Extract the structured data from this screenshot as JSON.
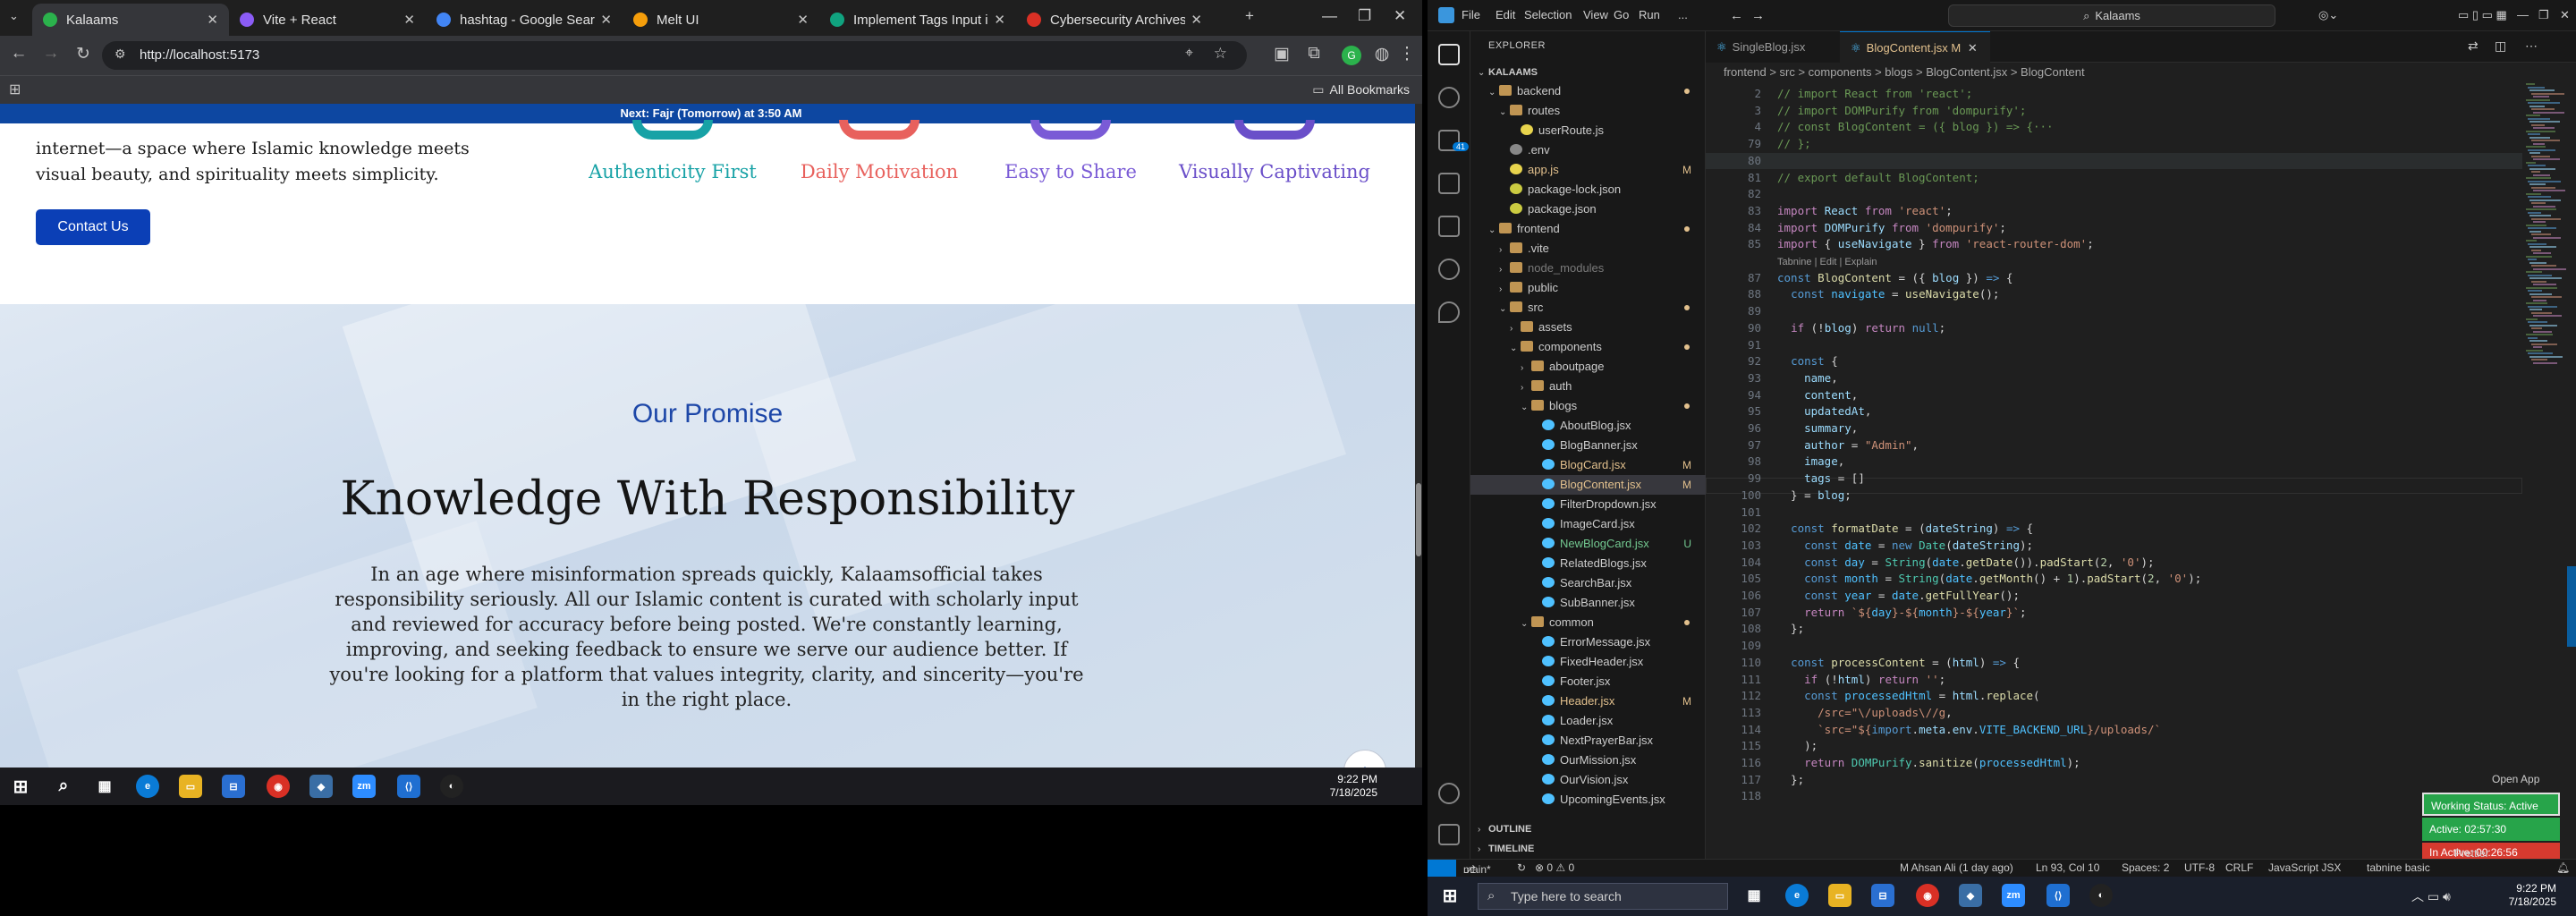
{
  "browser": {
    "tabs": [
      {
        "title": "Kalaams",
        "active": true,
        "color": "#2bb24c"
      },
      {
        "title": "Vite + React",
        "active": false,
        "color": "#8b5cf6"
      },
      {
        "title": "hashtag - Google Search",
        "active": false,
        "color": "#4285f4"
      },
      {
        "title": "Melt UI",
        "active": false,
        "color": "#f59e0b"
      },
      {
        "title": "Implement Tags Input in Blo",
        "active": false,
        "color": "#10a37f"
      },
      {
        "title": "Cybersecurity Archives - vCh",
        "active": false,
        "color": "#d93025"
      }
    ],
    "url": "http://localhost:5173",
    "bookmarks_label": "All Bookmarks"
  },
  "site": {
    "prayer_bar": "Next: Fajr (Tomorrow) at 3:50 AM",
    "hero_text": "internet—a space where Islamic knowledge meets visual beauty, and spirituality meets simplicity.",
    "contact_label": "Contact Us",
    "features": [
      {
        "label": "Authenticity First",
        "color": "#17a2a6"
      },
      {
        "label": "Daily Motivation",
        "color": "#e8615d"
      },
      {
        "label": "Easy to Share",
        "color": "#7a5bd6"
      },
      {
        "label": "Visually Captivating",
        "color": "#6a4fc9"
      }
    ],
    "promise_subtitle": "Our Promise",
    "promise_title": "Knowledge With Responsibility",
    "promise_body": "In an age where misinformation spreads quickly, Kalaamsofficial takes responsibility seriously. All our Islamic content is curated with scholarly input and reviewed for accuracy before being posted. We're constantly learning, improving, and seeking feedback to ensure we serve our audience better. If you're looking for a platform that values integrity, clarity, and sincerity—you're in the right place."
  },
  "left_taskbar": {
    "time": "9:22 PM",
    "date": "7/18/2025"
  },
  "vscode": {
    "menu": [
      "File",
      "Edit",
      "Selection",
      "View",
      "Go",
      "Run",
      "..."
    ],
    "search": "Kalaams",
    "explorer_title": "EXPLORER",
    "tree": [
      {
        "label": "KALAAMS",
        "depth": 0,
        "kind": "root",
        "chev": "⌄"
      },
      {
        "label": "backend",
        "depth": 1,
        "kind": "folder",
        "chev": "⌄",
        "dot": "#e2c08d"
      },
      {
        "label": "routes",
        "depth": 2,
        "kind": "folder",
        "chev": "⌄"
      },
      {
        "label": "userRoute.js",
        "depth": 3,
        "kind": "js"
      },
      {
        "label": ".env",
        "depth": 2,
        "kind": "env"
      },
      {
        "label": "app.js",
        "depth": 2,
        "kind": "js",
        "mark": "M",
        "color": "#e2c08d"
      },
      {
        "label": "package-lock.json",
        "depth": 2,
        "kind": "json"
      },
      {
        "label": "package.json",
        "depth": 2,
        "kind": "json"
      },
      {
        "label": "frontend",
        "depth": 1,
        "kind": "folder",
        "chev": "⌄",
        "dot": "#e2c08d"
      },
      {
        "label": ".vite",
        "depth": 2,
        "kind": "folder",
        "chev": "›"
      },
      {
        "label": "node_modules",
        "depth": 2,
        "kind": "folder",
        "chev": "›",
        "dim": true
      },
      {
        "label": "public",
        "depth": 2,
        "kind": "folder",
        "chev": "›"
      },
      {
        "label": "src",
        "depth": 2,
        "kind": "folder",
        "chev": "⌄",
        "dot": "#e2c08d"
      },
      {
        "label": "assets",
        "depth": 3,
        "kind": "folder",
        "chev": "›"
      },
      {
        "label": "components",
        "depth": 3,
        "kind": "folder",
        "chev": "⌄",
        "dot": "#e2c08d"
      },
      {
        "label": "aboutpage",
        "depth": 4,
        "kind": "folder",
        "chev": "›"
      },
      {
        "label": "auth",
        "depth": 4,
        "kind": "folder",
        "chev": "›"
      },
      {
        "label": "blogs",
        "depth": 4,
        "kind": "folder",
        "chev": "⌄",
        "dot": "#e2c08d"
      },
      {
        "label": "AboutBlog.jsx",
        "depth": 5,
        "kind": "jsx"
      },
      {
        "label": "BlogBanner.jsx",
        "depth": 5,
        "kind": "jsx"
      },
      {
        "label": "BlogCard.jsx",
        "depth": 5,
        "kind": "jsx",
        "mark": "M",
        "color": "#e2c08d"
      },
      {
        "label": "BlogContent.jsx",
        "depth": 5,
        "kind": "jsx",
        "mark": "M",
        "color": "#e2c08d",
        "selected": true
      },
      {
        "label": "FilterDropdown.jsx",
        "depth": 5,
        "kind": "jsx"
      },
      {
        "label": "ImageCard.jsx",
        "depth": 5,
        "kind": "jsx"
      },
      {
        "label": "NewBlogCard.jsx",
        "depth": 5,
        "kind": "jsx",
        "mark": "U",
        "color": "#73c991"
      },
      {
        "label": "RelatedBlogs.jsx",
        "depth": 5,
        "kind": "jsx"
      },
      {
        "label": "SearchBar.jsx",
        "depth": 5,
        "kind": "jsx"
      },
      {
        "label": "SubBanner.jsx",
        "depth": 5,
        "kind": "jsx"
      },
      {
        "label": "common",
        "depth": 4,
        "kind": "folder",
        "chev": "⌄",
        "dot": "#e2c08d"
      },
      {
        "label": "ErrorMessage.jsx",
        "depth": 5,
        "kind": "jsx"
      },
      {
        "label": "FixedHeader.jsx",
        "depth": 5,
        "kind": "jsx"
      },
      {
        "label": "Footer.jsx",
        "depth": 5,
        "kind": "jsx"
      },
      {
        "label": "Header.jsx",
        "depth": 5,
        "kind": "jsx",
        "mark": "M",
        "color": "#e2c08d"
      },
      {
        "label": "Loader.jsx",
        "depth": 5,
        "kind": "jsx"
      },
      {
        "label": "NextPrayerBar.jsx",
        "depth": 5,
        "kind": "jsx"
      },
      {
        "label": "OurMission.jsx",
        "depth": 5,
        "kind": "jsx"
      },
      {
        "label": "OurVision.jsx",
        "depth": 5,
        "kind": "jsx"
      },
      {
        "label": "UpcomingEvents.jsx",
        "depth": 5,
        "kind": "jsx"
      }
    ],
    "outline_label": "OUTLINE",
    "timeline_label": "TIMELINE",
    "editor_tabs": [
      {
        "label": "SingleBlog.jsx",
        "active": false
      },
      {
        "label": "BlogContent.jsx",
        "active": true,
        "mark": "M"
      }
    ],
    "breadcrumb": "frontend > src > components > blogs > BlogContent.jsx > BlogContent",
    "code_lines": [
      {
        "n": "2",
        "html": "<span class=\"cm\">// import React from 'react';</span>"
      },
      {
        "n": "3",
        "html": "<span class=\"cm\">// import DOMPurify from 'dompurify';</span>"
      },
      {
        "n": "4",
        "html": "<span class=\"cm\">// const BlogContent = ({ blog }) =&gt; {···</span>"
      },
      {
        "n": "79",
        "html": "<span class=\"cm\">// };</span>"
      },
      {
        "n": "80",
        "html": ""
      },
      {
        "n": "81",
        "html": "<span class=\"cm\">// export default BlogContent;</span>"
      },
      {
        "n": "82",
        "html": ""
      },
      {
        "n": "83",
        "html": "<span class=\"kc\">import</span> <span class=\"vr\">React</span> <span class=\"kc\">from</span> <span class=\"st\">'react'</span>;"
      },
      {
        "n": "84",
        "html": "<span class=\"kc\">import</span> <span class=\"vr\">DOMPurify</span> <span class=\"kc\">from</span> <span class=\"st\">'dompurify'</span>;"
      },
      {
        "n": "85",
        "html": "<span class=\"kc\">import</span> { <span class=\"vr\">useNavigate</span> } <span class=\"kc\">from</span> <span class=\"st\">'react-router-dom'</span>;"
      },
      {
        "n": "",
        "html": "<span style=\"color:#999;font-family:'Liberation Sans',sans-serif;font-size:11px\">Tabnine | Edit | Explain</span>"
      },
      {
        "n": "87",
        "html": "<span class=\"kw\">const</span> <span class=\"fn\">BlogContent</span> = ({ <span class=\"vr\">blog</span> }) <span class=\"kw\">=&gt;</span> {"
      },
      {
        "n": "88",
        "html": "  <span class=\"kw\">const</span> <span class=\"cn\">navigate</span> = <span class=\"fn\">useNavigate</span>();"
      },
      {
        "n": "89",
        "html": ""
      },
      {
        "n": "90",
        "html": "  <span class=\"kc\">if</span> (!<span class=\"vr\">blog</span>) <span class=\"kc\">return</span> <span class=\"kw\">null</span>;"
      },
      {
        "n": "91",
        "html": ""
      },
      {
        "n": "92",
        "html": "  <span class=\"kw\">const</span> {"
      },
      {
        "n": "93",
        "html": "    <span class=\"vr\">name</span>,"
      },
      {
        "n": "94",
        "html": "    <span class=\"vr\">content</span>,"
      },
      {
        "n": "95",
        "html": "    <span class=\"vr\">updatedAt</span>,"
      },
      {
        "n": "96",
        "html": "    <span class=\"vr\">summary</span>,"
      },
      {
        "n": "97",
        "html": "    <span class=\"vr\">author</span> = <span class=\"st\">\"Admin\"</span>,"
      },
      {
        "n": "98",
        "html": "    <span class=\"vr\">image</span>,"
      },
      {
        "n": "99",
        "html": "    <span class=\"vr\">tags</span> = []"
      },
      {
        "n": "100",
        "html": "  } = <span class=\"vr\">blog</span>;"
      },
      {
        "n": "101",
        "html": ""
      },
      {
        "n": "102",
        "html": "  <span class=\"kw\">const</span> <span class=\"fn\">formatDate</span> = (<span class=\"vr\">dateString</span>) <span class=\"kw\">=&gt;</span> {"
      },
      {
        "n": "103",
        "html": "    <span class=\"kw\">const</span> <span class=\"cn\">date</span> = <span class=\"kw\">new</span> <span class=\"ty\">Date</span>(<span class=\"vr\">dateString</span>);"
      },
      {
        "n": "104",
        "html": "    <span class=\"kw\">const</span> <span class=\"cn\">day</span> = <span class=\"ty\">String</span>(<span class=\"cn\">date</span>.<span class=\"fn\">getDate</span>()).<span class=\"fn\">padStart</span>(<span class=\"nu\">2</span>, <span class=\"st\">'0'</span>);"
      },
      {
        "n": "105",
        "html": "    <span class=\"kw\">const</span> <span class=\"cn\">month</span> = <span class=\"ty\">String</span>(<span class=\"cn\">date</span>.<span class=\"fn\">getMonth</span>() + <span class=\"nu\">1</span>).<span class=\"fn\">padStart</span>(<span class=\"nu\">2</span>, <span class=\"st\">'0'</span>);"
      },
      {
        "n": "106",
        "html": "    <span class=\"kw\">const</span> <span class=\"cn\">year</span> = <span class=\"cn\">date</span>.<span class=\"fn\">getFullYear</span>();"
      },
      {
        "n": "107",
        "html": "    <span class=\"kc\">return</span> <span class=\"st\">`${</span><span class=\"cn\">day</span><span class=\"st\">}-${</span><span class=\"cn\">month</span><span class=\"st\">}-${</span><span class=\"cn\">year</span><span class=\"st\">}`</span>;"
      },
      {
        "n": "108",
        "html": "  };"
      },
      {
        "n": "109",
        "html": ""
      },
      {
        "n": "110",
        "html": "  <span class=\"kw\">const</span> <span class=\"fn\">processContent</span> = (<span class=\"vr\">html</span>) <span class=\"kw\">=&gt;</span> {"
      },
      {
        "n": "111",
        "html": "    <span class=\"kc\">if</span> (!<span class=\"vr\">html</span>) <span class=\"kc\">return</span> <span class=\"st\">''</span>;"
      },
      {
        "n": "112",
        "html": "    <span class=\"kw\">const</span> <span class=\"cn\">processedHtml</span> = <span class=\"vr\">html</span>.<span class=\"fn\">replace</span>("
      },
      {
        "n": "113",
        "html": "      <span class=\"st\">/src=\"\\/uploads\\//g</span>,"
      },
      {
        "n": "114",
        "html": "      <span class=\"st\">`src=\"${</span><span class=\"kw\">import</span>.<span class=\"vr\">meta</span>.<span class=\"vr\">env</span>.<span class=\"cn\">VITE_BACKEND_URL</span><span class=\"st\">}/uploads/`</span>"
      },
      {
        "n": "115",
        "html": "    );"
      },
      {
        "n": "116",
        "html": "    <span class=\"kc\">return</span> <span class=\"ty\">DOMPurify</span>.<span class=\"fn\">sanitize</span>(<span class=\"cn\">processedHtml</span>);"
      },
      {
        "n": "117",
        "html": "  };"
      },
      {
        "n": "118",
        "html": ""
      }
    ],
    "status": {
      "branch": "main*",
      "errors": "⊗ 0 ⚠ 0",
      "blame": "M Ahsan Ali (1 day ago)",
      "cursor": "Ln 93, Col 10",
      "spaces": "Spaces: 2",
      "encoding": "UTF-8",
      "eol": "CRLF",
      "language": "JavaScript JSX",
      "tabnine": "tabnine basic",
      "prettier": "Prettier"
    },
    "open_app": "Open App",
    "working_status": "Working Status: Active",
    "active_time": "Active: 02:57:30",
    "inactive_time": "In Active: 00:26:56"
  },
  "right_taskbar": {
    "search_placeholder": "Type here to search",
    "time": "9:22 PM",
    "date": "7/18/2025"
  }
}
